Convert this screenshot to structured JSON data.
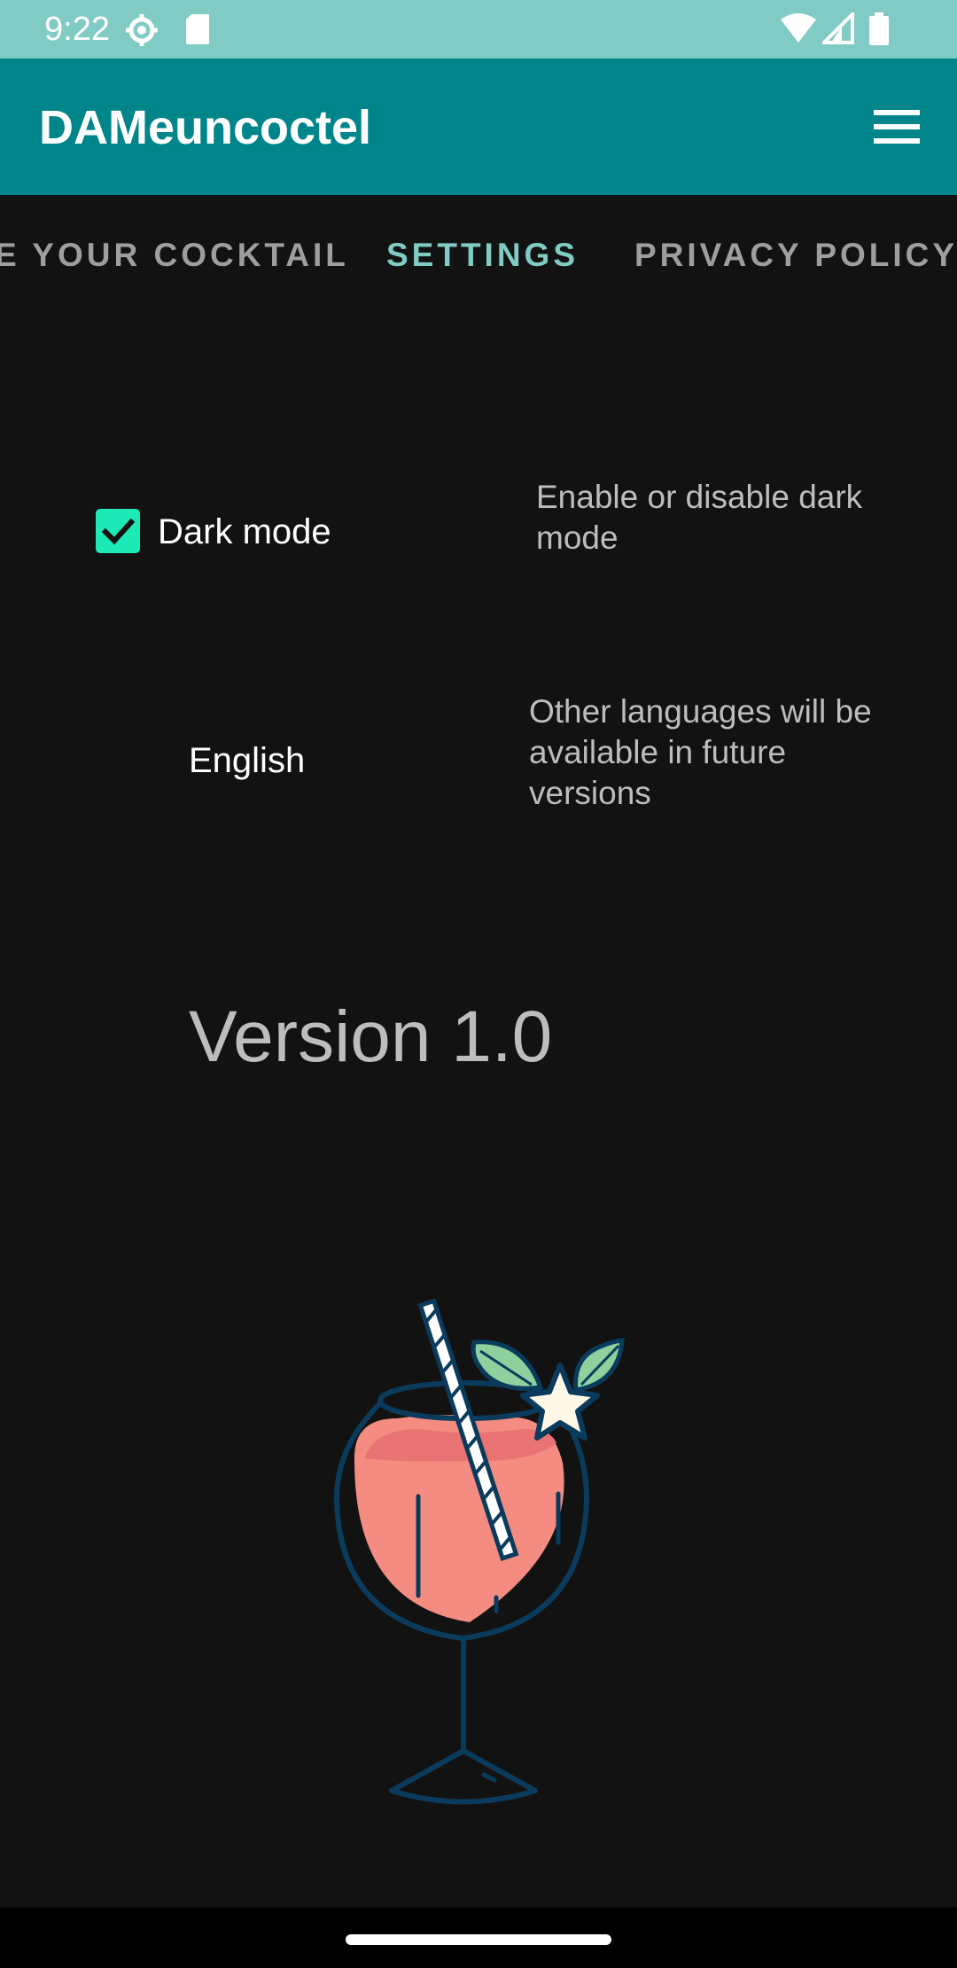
{
  "status_bar": {
    "time": "9:22",
    "icons": [
      "settings-icon",
      "sd-card-icon",
      "wifi-icon",
      "signal-icon",
      "battery-icon"
    ]
  },
  "app_bar": {
    "title": "DAMeuncoctel",
    "menu_icon": "hamburger-menu-icon"
  },
  "tabs": [
    {
      "label": "E YOUR COCKTAIL",
      "active": false
    },
    {
      "label": "SETTINGS",
      "active": true
    },
    {
      "label": "PRIVACY POLICY",
      "active": false
    }
  ],
  "settings": {
    "dark_mode": {
      "label": "Dark mode",
      "checked": true,
      "hint": "Enable or disable dark mode"
    },
    "language": {
      "value": "English",
      "hint": "Other languages will be available in future versions"
    },
    "version": "Version 1.0"
  },
  "colors": {
    "status_bar": "#80cbc4",
    "app_bar": "#00868a",
    "accent": "#1de9b6",
    "active_tab": "#80cbc4",
    "background": "#121212"
  }
}
